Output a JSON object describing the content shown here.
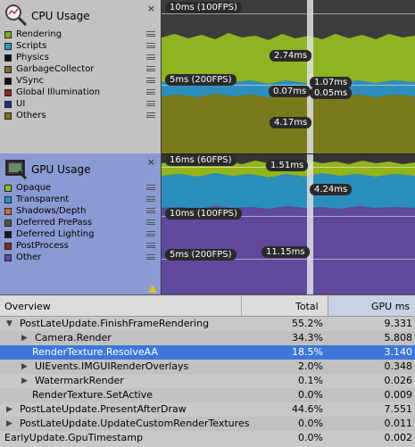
{
  "cpu": {
    "title": "CPU Usage",
    "close": "×",
    "legend": [
      {
        "label": "Rendering",
        "color": "#80b020"
      },
      {
        "label": "Scripts",
        "color": "#2f9bc4"
      },
      {
        "label": "Physics",
        "color": "#111111"
      },
      {
        "label": "GarbageCollector",
        "color": "#7a6a35"
      },
      {
        "label": "VSync",
        "color": "#0a0a0a"
      },
      {
        "label": "Global Illumination",
        "color": "#8a2a1a"
      },
      {
        "label": "UI",
        "color": "#1a2e8a"
      },
      {
        "label": "Others",
        "color": "#7a7a1a"
      }
    ],
    "chart": {
      "line_top": "10ms (100FPS)",
      "line_mid": "5ms (200FPS)",
      "values": [
        "2.74ms",
        "1.07ms",
        "0.07ms",
        "0.05ms",
        "4.17ms"
      ]
    }
  },
  "gpu": {
    "title": "GPU Usage",
    "close": "×",
    "legend": [
      {
        "label": "Opaque",
        "color": "#98b820"
      },
      {
        "label": "Transparent",
        "color": "#2b95c3"
      },
      {
        "label": "Shadows/Depth",
        "color": "#c07030"
      },
      {
        "label": "Deferred PrePass",
        "color": "#5a5a3a"
      },
      {
        "label": "Deferred Lighting",
        "color": "#1a1a1a"
      },
      {
        "label": "PostProcess",
        "color": "#8a2a1a"
      },
      {
        "label": "Other",
        "color": "#5a4aa8"
      }
    ],
    "chart": {
      "line_top": "16ms (60FPS)",
      "line_mid": "10ms (100FPS)",
      "line_low": "5ms (200FPS)",
      "values": [
        "1.51ms",
        "4.24ms",
        "11.15ms"
      ]
    }
  },
  "table": {
    "headers": {
      "overview": "Overview",
      "total": "Total",
      "gpu_ms": "GPU ms"
    },
    "rows": [
      {
        "name": "PostLateUpdate.FinishFrameRendering",
        "total": "55.2%",
        "gpu": "9.331",
        "arrow": "▼"
      },
      {
        "name": "Camera.Render",
        "total": "34.3%",
        "gpu": "5.808",
        "arrow": "▶"
      },
      {
        "name": "RenderTexture.ResolveAA",
        "total": "18.5%",
        "gpu": "3.140",
        "arrow": ""
      },
      {
        "name": "UIEvents.IMGUIRenderOverlays",
        "total": "2.0%",
        "gpu": "0.348",
        "arrow": "▶"
      },
      {
        "name": "WatermarkRender",
        "total": "0.1%",
        "gpu": "0.026",
        "arrow": "▶"
      },
      {
        "name": "RenderTexture.SetActive",
        "total": "0.0%",
        "gpu": "0.009",
        "arrow": ""
      },
      {
        "name": "PostLateUpdate.PresentAfterDraw",
        "total": "44.6%",
        "gpu": "7.551",
        "arrow": "▶"
      },
      {
        "name": "PostLateUpdate.UpdateCustomRenderTextures",
        "total": "0.0%",
        "gpu": "0.011",
        "arrow": "▶"
      },
      {
        "name": "EarlyUpdate.GpuTimestamp",
        "total": "0.0%",
        "gpu": "0.002",
        "arrow": ""
      }
    ]
  }
}
